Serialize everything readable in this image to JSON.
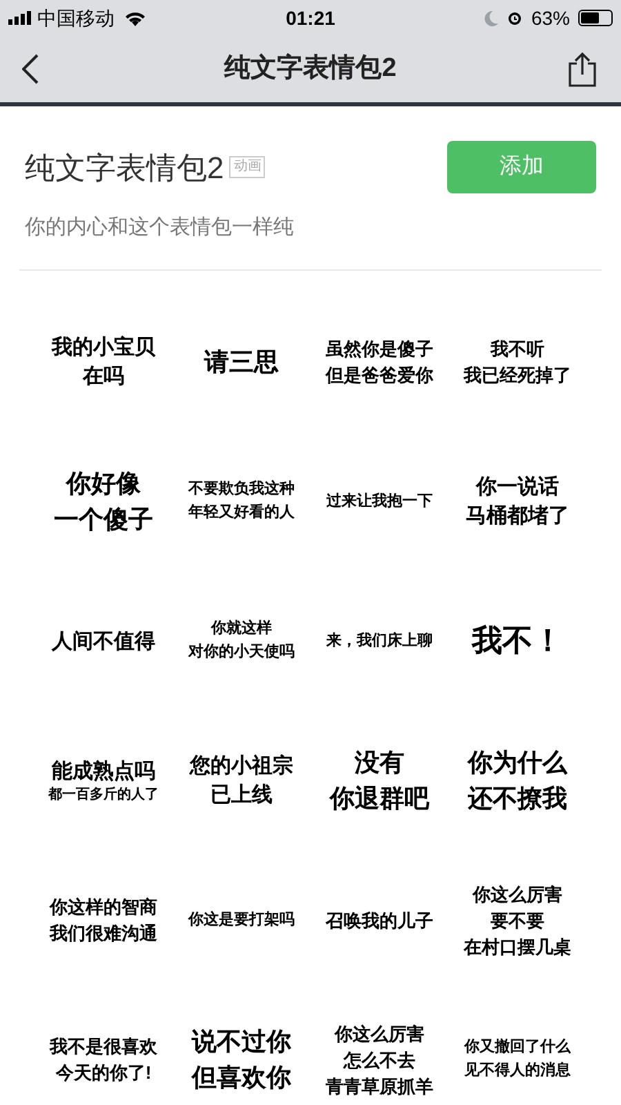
{
  "status_bar": {
    "carrier": "中国移动",
    "time": "01:21",
    "battery": "63%"
  },
  "nav": {
    "title": "纯文字表情包2"
  },
  "pack": {
    "title": "纯文字表情包2",
    "tag": "动画",
    "add_button": "添加",
    "description": "你的内心和这个表情包一样纯"
  },
  "stickers": [
    {
      "lines": [
        "我的小宝贝",
        "在吗"
      ],
      "kind": "medium"
    },
    {
      "lines": [
        "请三思"
      ],
      "kind": "large"
    },
    {
      "lines": [
        "虽然你是傻子",
        "但是爸爸爱你"
      ],
      "kind": "normal"
    },
    {
      "lines": [
        "我不听",
        "我已经死掉了"
      ],
      "kind": "normal"
    },
    {
      "lines": [
        "你好像",
        "一个傻子"
      ],
      "kind": "large"
    },
    {
      "lines": [
        "不要欺负我这种",
        "年轻又好看的人"
      ],
      "kind": "small"
    },
    {
      "lines": [
        "过来让我抱一下"
      ],
      "kind": "small"
    },
    {
      "lines": [
        "你一说话",
        "马桶都堵了"
      ],
      "kind": "medium"
    },
    {
      "lines": [
        "人间不值得"
      ],
      "kind": "medium"
    },
    {
      "lines": [
        "你就这样",
        "对你的小天使吗"
      ],
      "kind": "small"
    },
    {
      "lines": [
        "来，我们床上聊"
      ],
      "kind": "small"
    },
    {
      "lines": [
        "我不！"
      ],
      "kind": "xl"
    },
    {
      "lines": [
        "能成熟点吗"
      ],
      "kind": "captioned",
      "caption": "都一百多斤的人了"
    },
    {
      "lines": [
        "您的小祖宗",
        "已上线"
      ],
      "kind": "medium"
    },
    {
      "lines": [
        "没有",
        "你退群吧"
      ],
      "kind": "large"
    },
    {
      "lines": [
        "你为什么",
        "还不撩我"
      ],
      "kind": "large"
    },
    {
      "lines": [
        "你这样的智商",
        "我们很难沟通"
      ],
      "kind": "normal"
    },
    {
      "lines": [
        "你这是要打架吗"
      ],
      "kind": "small"
    },
    {
      "lines": [
        "召唤我的儿子"
      ],
      "kind": "normal"
    },
    {
      "lines": [
        "你这么厉害",
        "要不要",
        "在村口摆几桌"
      ],
      "kind": "normal"
    },
    {
      "lines": [
        "我不是很喜欢",
        "今天的你了!"
      ],
      "kind": "normal"
    },
    {
      "lines": [
        "说不过你",
        "但喜欢你"
      ],
      "kind": "large"
    },
    {
      "lines": [
        "你这么厉害",
        "怎么不去",
        "青青草原抓羊"
      ],
      "kind": "normal"
    },
    {
      "lines": [
        "你又撤回了什么",
        "见不得人的消息"
      ],
      "kind": "small"
    }
  ]
}
